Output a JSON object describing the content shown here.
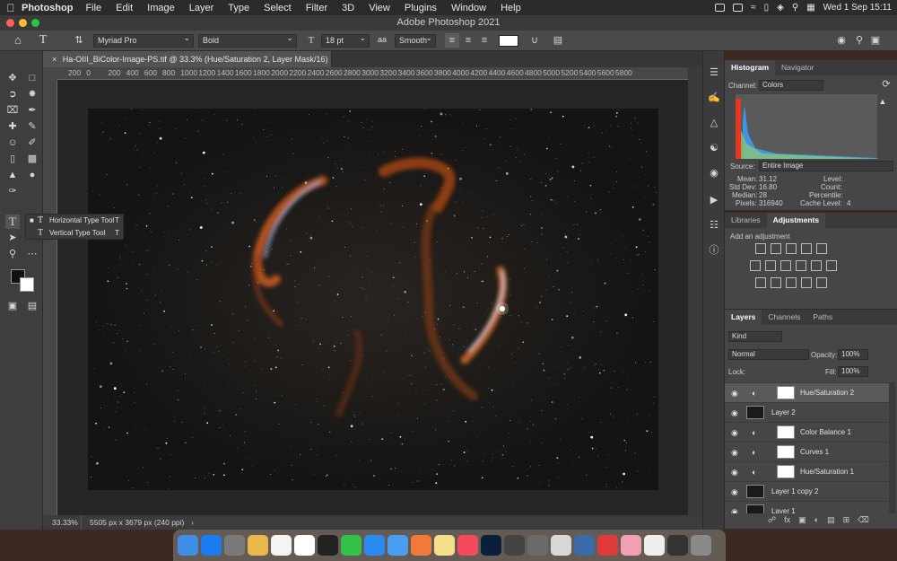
{
  "menubar": {
    "app_name": "Photoshop",
    "items": [
      "File",
      "Edit",
      "Image",
      "Layer",
      "Type",
      "Select",
      "Filter",
      "3D",
      "View",
      "Plugins",
      "Window",
      "Help"
    ],
    "clock": "Wed 1 Sep  15:11"
  },
  "window": {
    "title": "Adobe Photoshop 2021"
  },
  "options_bar": {
    "font_family": "Myriad Pro",
    "font_style": "Bold",
    "font_size": "18 pt",
    "antialias_icon": "aa",
    "antialias": "Smooth"
  },
  "document": {
    "tab_title": "Ha-OIII_BiColor-Image-PS.tif @ 33.3% (Hue/Saturation 2, Layer Mask/16) *",
    "ruler_ticks": [
      "200",
      "0",
      "200",
      "400",
      "600",
      "800",
      "1000",
      "1200",
      "1400",
      "1600",
      "1800",
      "2000",
      "2200",
      "2400",
      "2600",
      "2800",
      "3000",
      "3200",
      "3400",
      "3600",
      "3800",
      "4000",
      "4200",
      "4400",
      "4600",
      "4800",
      "5000",
      "5200",
      "5400",
      "5600",
      "5800"
    ],
    "zoom": "33.33%",
    "dimensions": "5505 px x 3679 px (240 ppi)"
  },
  "type_tool_flyout": [
    {
      "label": "Horizontal Type Tool",
      "shortcut": "T"
    },
    {
      "label": "Vertical Type Tool",
      "shortcut": "T"
    }
  ],
  "histogram": {
    "tabs": [
      "Histogram",
      "Navigator"
    ],
    "channel_label": "Channel:",
    "channel": "Colors",
    "source_label": "Source:",
    "source": "Entire Image",
    "stats": {
      "mean_label": "Mean:",
      "mean": "31.12",
      "stddev_label": "Std Dev:",
      "stddev": "16.80",
      "median_label": "Median:",
      "median": "28",
      "pixels_label": "Pixels:",
      "pixels": "316940",
      "level_label": "Level:",
      "count_label": "Count:",
      "percentile_label": "Percentile:",
      "cache_label": "Cache Level:",
      "cache": "4"
    }
  },
  "adjustments": {
    "tabs": [
      "Libraries",
      "Adjustments"
    ],
    "hint": "Add an adjustment"
  },
  "layers": {
    "tabs": [
      "Layers",
      "Channels",
      "Paths"
    ],
    "kind": "Kind",
    "blend_mode": "Normal",
    "opacity_label": "Opacity:",
    "opacity": "100%",
    "lock_label": "Lock:",
    "fill_label": "Fill:",
    "fill": "100%",
    "rows": [
      {
        "name": "Hue/Saturation 2",
        "type": "adjustment",
        "selected": true
      },
      {
        "name": "Layer 2",
        "type": "pixel"
      },
      {
        "name": "Color Balance 1",
        "type": "adjustment"
      },
      {
        "name": "Curves 1",
        "type": "adjustment"
      },
      {
        "name": "Hue/Saturation 1",
        "type": "adjustment"
      },
      {
        "name": "Layer 1 copy 2",
        "type": "pixel"
      },
      {
        "name": "Layer 1",
        "type": "pixel"
      }
    ]
  },
  "colors": {
    "menubar": "#2b2b2b",
    "panel": "#464646",
    "canvas_bg": "#262626",
    "accent_red": "#ff5f57",
    "accent_yellow": "#febc2e",
    "accent_green": "#28c840"
  }
}
